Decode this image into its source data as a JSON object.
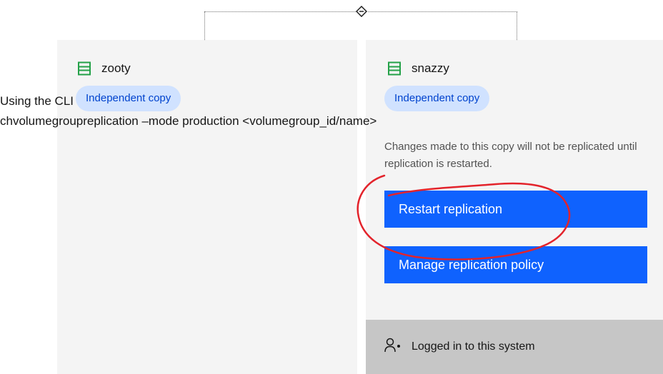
{
  "topology": {
    "connector_icon": "diamond-link-icon"
  },
  "source_system": {
    "name": "zooty",
    "icon": "storage-system-icon",
    "status_tag": "Independent copy"
  },
  "target_system": {
    "name": "snazzy",
    "icon": "storage-system-icon",
    "status_tag": "Independent copy",
    "note": "Changes made to this copy will not be replicated until replication is restarted.",
    "restart_button": "Restart replication",
    "manage_button": "Manage replication policy",
    "login_status": "Logged in to this system",
    "login_icon": "user-logged-in-icon"
  },
  "cli_overlay": {
    "line1": "Using the CLI",
    "line2": "chvolumegroupreplication –mode production <volumegroup_id/name>"
  },
  "colors": {
    "primary_button": "#0f62fe",
    "tag_background": "#d0e2ff",
    "tag_text": "#0043ce",
    "system_icon": "#24a148",
    "annotation_stroke": "#e3232b"
  }
}
